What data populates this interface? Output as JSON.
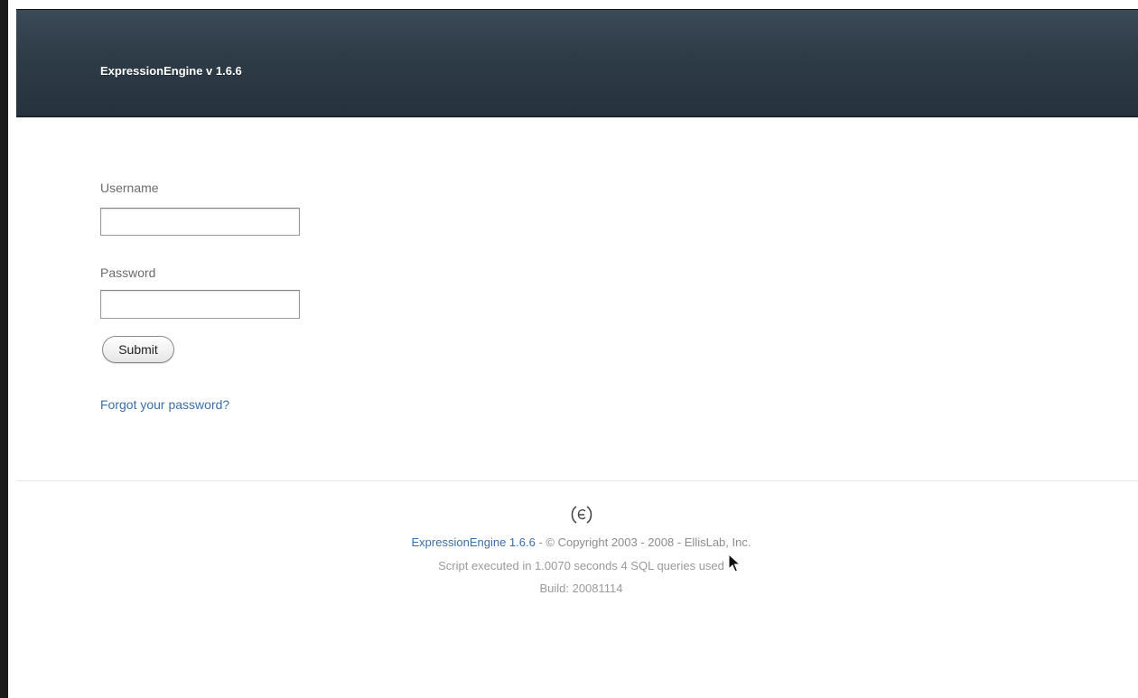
{
  "header": {
    "title": "ExpressionEngine  v 1.6.6"
  },
  "login": {
    "username_label": "Username",
    "username_value": "",
    "password_label": "Password",
    "password_value": "",
    "submit_label": "Submit",
    "forgot_label": "Forgot your password?"
  },
  "footer": {
    "logo_icon": "ee-logo-icon",
    "product_link": "ExpressionEngine 1.6.6",
    "copyright": " - © Copyright 2003 - 2008 - EllisLab, Inc.",
    "script_info": "Script executed in 1.0070 seconds   4 SQL queries used",
    "build": "Build:  20081114"
  },
  "colors": {
    "header_bg": "#2f3d49",
    "link": "#3a6ea8",
    "muted_text": "#8c8c8c"
  }
}
